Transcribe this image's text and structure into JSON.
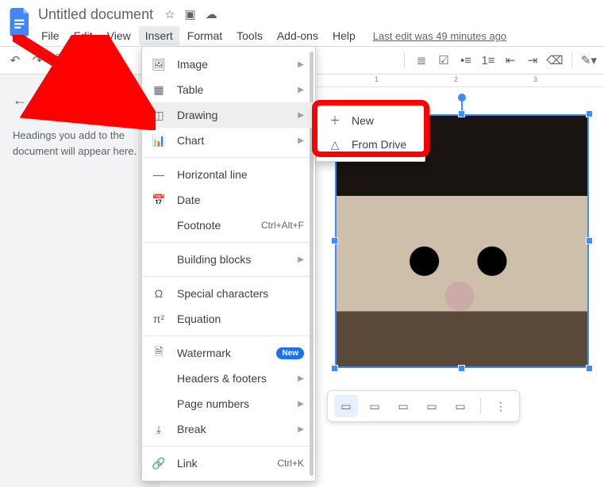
{
  "header": {
    "title": "Untitled document",
    "menubar": [
      "File",
      "Edit",
      "View",
      "Insert",
      "Format",
      "Tools",
      "Add-ons",
      "Help"
    ],
    "active_menu_index": 3,
    "last_edit": "Last edit was 49 minutes ago"
  },
  "outline": {
    "message": "Headings you add to the document will appear here."
  },
  "insert_menu": [
    {
      "icon": "image",
      "label": "Image",
      "submenu": true
    },
    {
      "icon": "table",
      "label": "Table",
      "submenu": true
    },
    {
      "icon": "drawing",
      "label": "Drawing",
      "submenu": true,
      "hover": true
    },
    {
      "icon": "chart",
      "label": "Chart",
      "submenu": true
    },
    {
      "divider": true
    },
    {
      "icon": "hr",
      "label": "Horizontal line"
    },
    {
      "icon": "date",
      "label": "Date"
    },
    {
      "icon": "",
      "label": "Footnote",
      "shortcut": "Ctrl+Alt+F"
    },
    {
      "divider": true
    },
    {
      "icon": "",
      "label": "Building blocks",
      "submenu": true
    },
    {
      "divider": true
    },
    {
      "icon": "omega",
      "label": "Special characters"
    },
    {
      "icon": "pi",
      "label": "Equation"
    },
    {
      "divider": true
    },
    {
      "icon": "watermark",
      "label": "Watermark",
      "badge": "New"
    },
    {
      "icon": "",
      "label": "Headers & footers",
      "submenu": true
    },
    {
      "icon": "",
      "label": "Page numbers",
      "submenu": true
    },
    {
      "icon": "break",
      "label": "Break",
      "submenu": true
    },
    {
      "divider": true
    },
    {
      "icon": "link",
      "label": "Link",
      "shortcut": "Ctrl+K"
    }
  ],
  "drawing_submenu": [
    {
      "icon": "plus",
      "label": "New"
    },
    {
      "icon": "drive",
      "label": "From Drive"
    }
  ],
  "ruler": {
    "marks": [
      "1",
      "2",
      "3"
    ]
  },
  "image_toolbar": {
    "options": [
      "inline",
      "wrap",
      "break",
      "behind",
      "front"
    ],
    "selected": 0,
    "more": "⋮"
  }
}
